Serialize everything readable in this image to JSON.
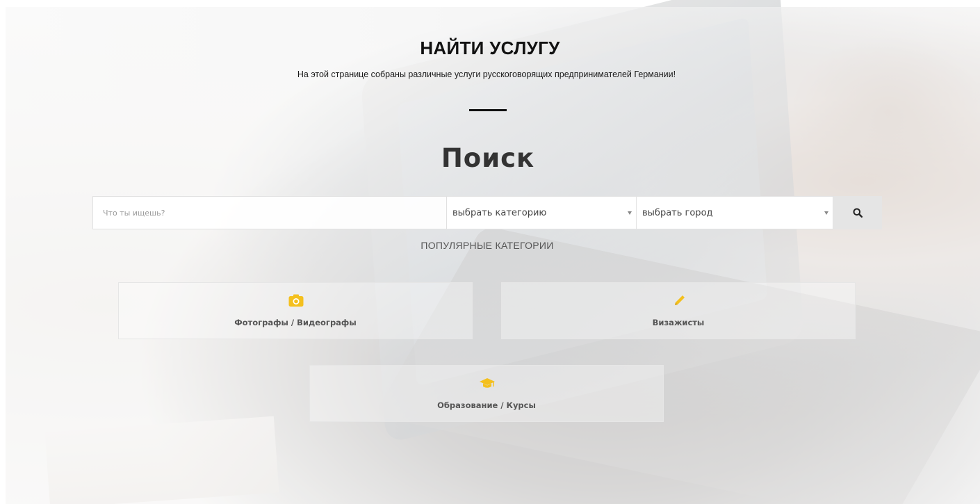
{
  "header": {
    "title": "НАЙТИ УСЛУГУ",
    "subtitle": "На этой странице собраны различные услуги русскоговорящих предпринимателей Германии!"
  },
  "search": {
    "heading": "Поиск",
    "input_placeholder": "Что ты ищешь?",
    "category_select": "выбрать категорию",
    "city_select": "выбрать город",
    "button_icon": "search-icon"
  },
  "popular": {
    "heading": "ПОПУЛЯРНЫЕ КАТЕГОРИИ",
    "categories": [
      {
        "label": "Фотографы / Видеографы",
        "icon": "camera-icon"
      },
      {
        "label": "Визажисты",
        "icon": "pencil-icon"
      },
      {
        "label": "Образование / Курсы",
        "icon": "graduation-cap-icon"
      }
    ]
  },
  "colors": {
    "accent": "#f4c01e",
    "title": "#111111",
    "text_muted": "#555555"
  }
}
